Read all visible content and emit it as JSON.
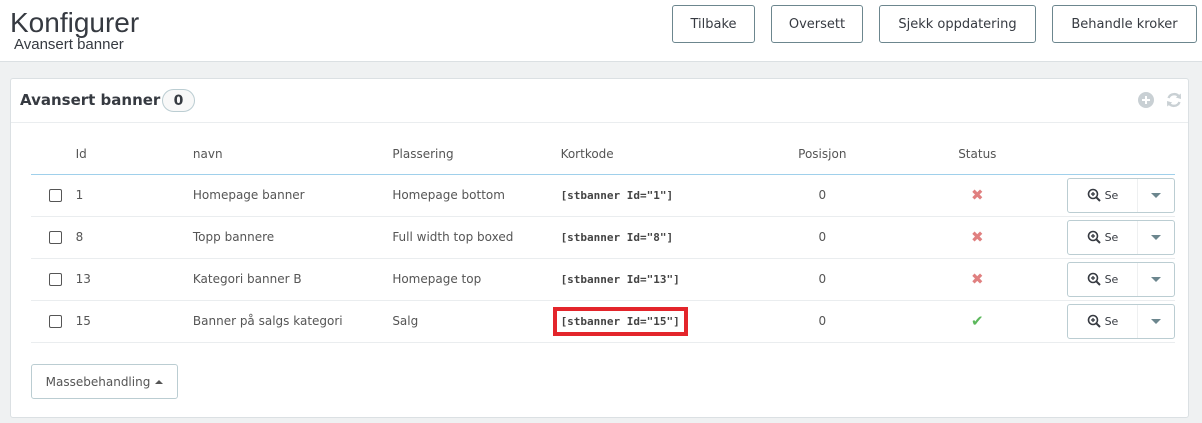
{
  "header": {
    "title": "Konfigurer",
    "subtitle": "Avansert banner",
    "buttons": {
      "back": "Tilbake",
      "translate": "Oversett",
      "check_update": "Sjekk oppdatering",
      "manage_hooks": "Behandle kroker"
    }
  },
  "panel": {
    "title": "Avansert banner",
    "count": "0",
    "icons": [
      "add-icon",
      "refresh-icon"
    ]
  },
  "table": {
    "columns": {
      "id": "Id",
      "name": "navn",
      "placement": "Plassering",
      "shortcode": "Kortkode",
      "position": "Posisjon",
      "status": "Status"
    },
    "rows": [
      {
        "id": "1",
        "name": "Homepage banner",
        "placement": "Homepage bottom",
        "shortcode": "[stbanner Id=\"1\"]",
        "position": "0",
        "status": "✖",
        "action": "Se"
      },
      {
        "id": "8",
        "name": "Topp bannere",
        "placement": "Full width top boxed",
        "shortcode": "[stbanner Id=\"8\"]",
        "position": "0",
        "status": "✖",
        "action": "Se"
      },
      {
        "id": "13",
        "name": "Kategori banner B",
        "placement": "Homepage top",
        "shortcode": "[stbanner Id=\"13\"]",
        "position": "0",
        "status": "✖",
        "action": "Se"
      },
      {
        "id": "15",
        "name": "Banner på salgs kategori",
        "placement": "Salg",
        "shortcode": "[stbanner Id=\"15\"]",
        "position": "0",
        "status": "✔",
        "action": "Se"
      }
    ]
  },
  "bulk": {
    "label": "Massebehandling"
  },
  "colors": {
    "status_disabled": "#e08080",
    "status_enabled": "#5cb85c",
    "highlight": "#e3252b"
  }
}
